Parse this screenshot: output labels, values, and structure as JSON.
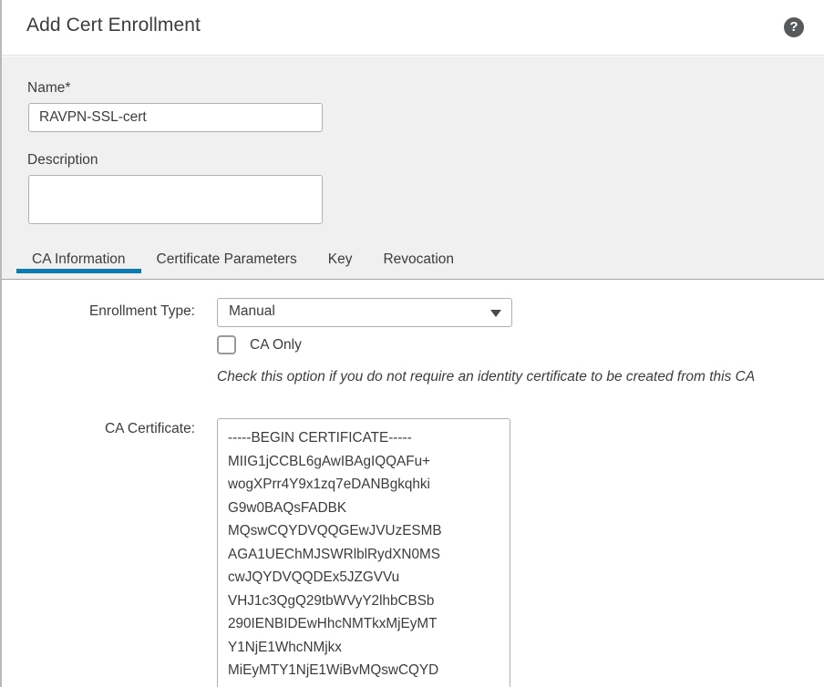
{
  "header": {
    "title": "Add Cert Enrollment",
    "help_icon": "help-circle-icon",
    "help_glyph": "?"
  },
  "form": {
    "name_label": "Name*",
    "name_value": "RAVPN-SSL-cert",
    "name_placeholder": "",
    "description_label": "Description",
    "description_value": "",
    "description_placeholder": ""
  },
  "tabs": [
    {
      "label": "CA Information",
      "active": true
    },
    {
      "label": "Certificate Parameters",
      "active": false
    },
    {
      "label": "Key",
      "active": false
    },
    {
      "label": "Revocation",
      "active": false
    }
  ],
  "ca_information": {
    "enrollment_type_label": "Enrollment Type:",
    "enrollment_type_value": "Manual",
    "enrollment_type_options": [
      "Manual"
    ],
    "ca_only_label": "CA Only",
    "ca_only_checked": false,
    "help_text": "Check this option if you do not require an identity certificate to be created from this CA",
    "ca_certificate_label": "CA Certificate:",
    "ca_certificate_value": "-----BEGIN CERTIFICATE-----\nMIIG1jCCBL6gAwIBAgIQQAFu+\nwogXPrr4Y9x1zq7eDANBgkqhki\nG9w0BAQsFADBK\nMQswCQYDVQQGEwJVUzESMB\nAGA1UEChMJSWRlblRydXN0MS\ncwJQYDVQQDEx5JZGVVu\nVHJ1c3QgQ29tbWVyY2lhbCBSb\n290IENBIDEwHhcNMTkxMjEyMT\nY1NjE1WhcNMjkx\nMiEyMTY1NjE1WiBvMQswCQYD"
  },
  "colors": {
    "accent": "#0d7bad",
    "header_bg": "#ffffff",
    "panel_bg": "#f0f0f0",
    "content_bg": "#ffffff",
    "text": "#3c3c3c",
    "border": "#b0b0b0",
    "help_icon_bg": "#58595b"
  }
}
